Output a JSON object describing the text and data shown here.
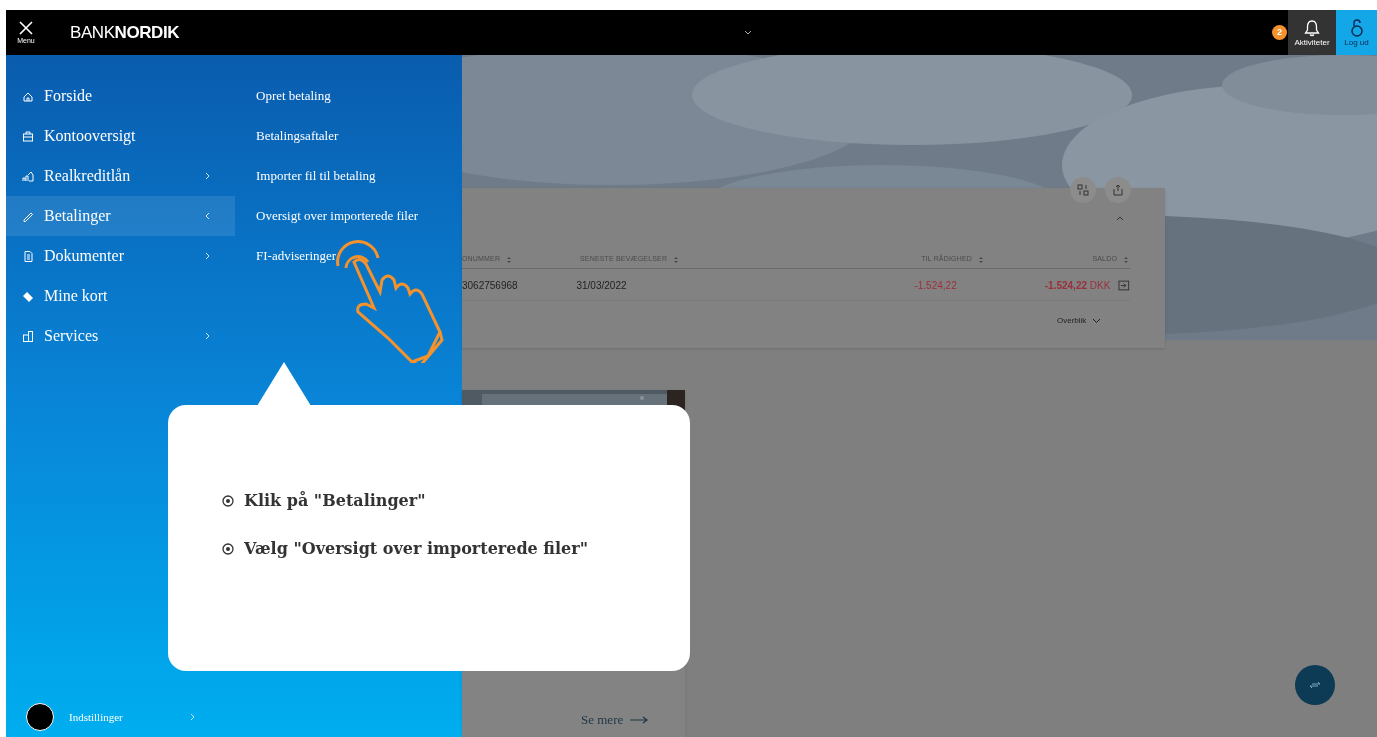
{
  "header": {
    "menu_label": "Menu",
    "logo": {
      "light": "BANK",
      "bold": "NORDIK"
    },
    "notifications": {
      "count": "2",
      "label": "Aktiviteter"
    },
    "logout": "Log ud"
  },
  "menu": {
    "items": [
      {
        "label": "Forside",
        "has_submenu": false,
        "selected": false
      },
      {
        "label": "Kontooversigt",
        "has_submenu": false,
        "selected": false
      },
      {
        "label": "Realkreditlån",
        "has_submenu": true,
        "selected": false
      },
      {
        "label": "Betalinger",
        "has_submenu": true,
        "selected": true
      },
      {
        "label": "Dokumenter",
        "has_submenu": true,
        "selected": false
      },
      {
        "label": "Mine kort",
        "has_submenu": false,
        "selected": false
      },
      {
        "label": "Services",
        "has_submenu": true,
        "selected": false
      }
    ],
    "submenu": [
      "Opret betaling",
      "Betalingsaftaler",
      "Importer fil til betaling",
      "Oversigt over importerede filer",
      "FI-adviseringer"
    ],
    "settings": "Indstillinger"
  },
  "account_card": {
    "columns": [
      "ONUMMER",
      "SENESTE BEVÆGELSER",
      "TIL RÅDIGHED",
      "SALDO"
    ],
    "rows": [
      {
        "account": "3062756968",
        "last_activity": "31/03/2022",
        "available": "-1.524,22",
        "balance": "-1.524,22",
        "currency": "DKK"
      }
    ],
    "toggle": "Overblik"
  },
  "news_card": {
    "link": "Se mere"
  },
  "tooltip": {
    "steps": [
      "Klik på \"Betalinger\"",
      "Vælg \"Oversigt over importerede filer\""
    ]
  }
}
